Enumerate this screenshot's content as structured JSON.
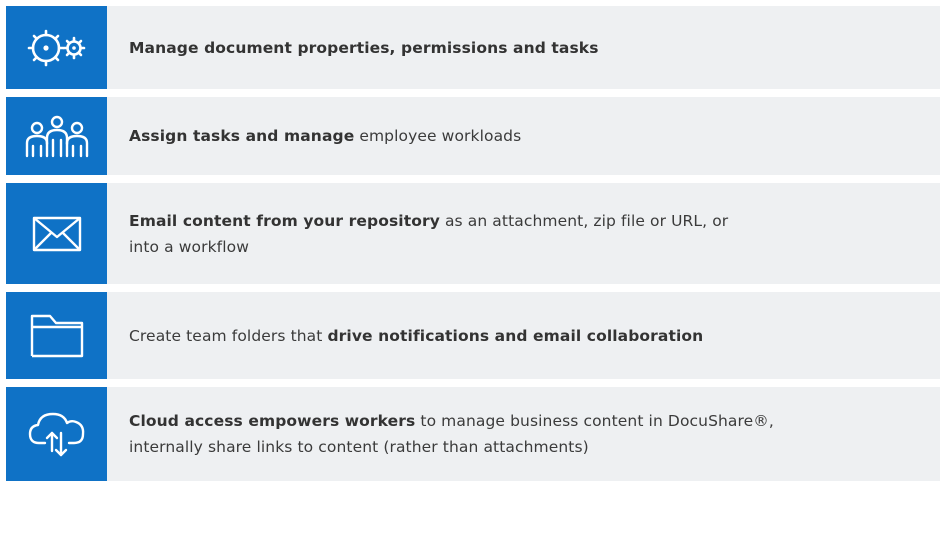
{
  "rows": [
    {
      "icon": "gears-icon",
      "parts": [
        {
          "text": "Manage document properties, permissions and tasks",
          "bold": true
        }
      ]
    },
    {
      "icon": "people-icon",
      "parts": [
        {
          "text": "Assign tasks and manage",
          "bold": true
        },
        {
          "text": " employee workloads",
          "bold": false
        }
      ]
    },
    {
      "icon": "envelope-icon",
      "parts": [
        {
          "text": "Email content from your repository",
          "bold": true
        },
        {
          "text": " as an attachment, zip file or URL, or",
          "bold": false
        },
        {
          "text": "into a workflow",
          "bold": false
        }
      ]
    },
    {
      "icon": "folder-icon",
      "parts": [
        {
          "text": "Create team folders that ",
          "bold": false
        },
        {
          "text": "drive notifications and email collaboration",
          "bold": true
        }
      ]
    },
    {
      "icon": "cloud-upload-download-icon",
      "parts": [
        {
          "text": "Cloud access empowers workers",
          "bold": true
        },
        {
          "text": " to manage business content in DocuShare®,",
          "bold": false
        },
        {
          "text": "internally share links to content (rather than attachments)",
          "bold": false
        }
      ]
    }
  ],
  "colors": {
    "icon_background": "#0f72c6",
    "panel_background": "#eef0f2",
    "text": "#3b3b3b"
  }
}
